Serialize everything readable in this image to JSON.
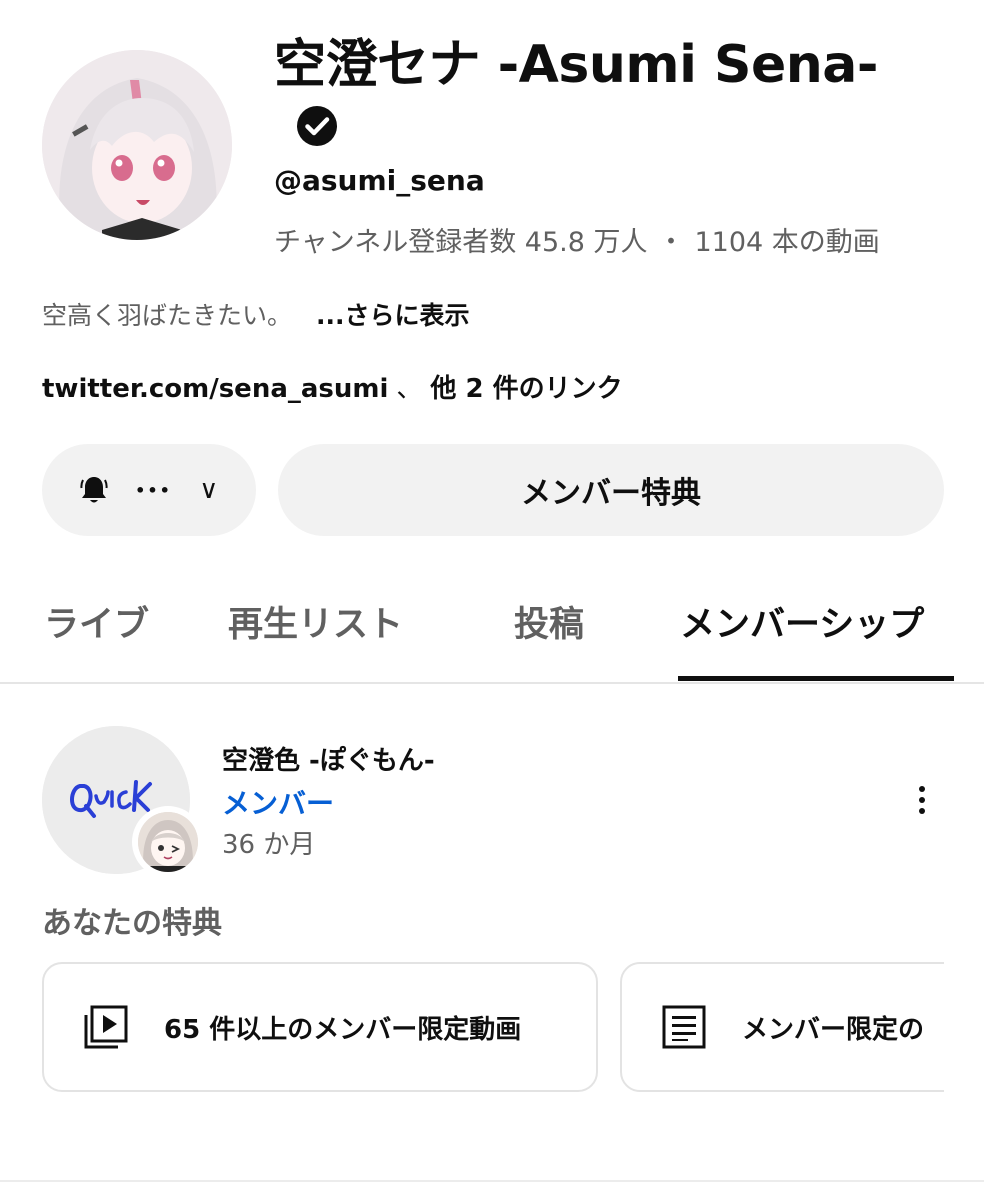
{
  "channel": {
    "name": "空澄セナ -Asumi Sena-",
    "handle": "@asumi_sena",
    "subscribers": "チャンネル登録者数 45.8 万人",
    "separator": "・",
    "video_count": "1104 本の動画",
    "description": "空高く羽ばたきたい。",
    "more_label": "...さらに表示",
    "link_url": "twitter.com/sena_asumi",
    "link_sep": "、",
    "link_more": "他 2 件のリンク"
  },
  "actions": {
    "bell_icon": "bell-icon",
    "more_dots": "•••",
    "chevron": "∨",
    "member_perks_label": "メンバー特典"
  },
  "tabs": [
    {
      "label": "ライブ",
      "active": false
    },
    {
      "label": "再生リスト",
      "active": false
    },
    {
      "label": "投稿",
      "active": false
    },
    {
      "label": "メンバーシップ",
      "active": true
    }
  ],
  "membership": {
    "title": "空澄色 -ぽぐもん-",
    "level": "メンバー",
    "duration": "36 か月",
    "perks_heading": "あなたの特典",
    "perks": [
      {
        "icon": "video-library-icon",
        "label": "65 件以上のメンバー限定動画"
      },
      {
        "icon": "article-icon",
        "label": "メンバー限定の"
      }
    ]
  },
  "colors": {
    "link_blue": "#065fd4",
    "secondary_text": "#606060",
    "pill_bg": "#f2f2f2"
  }
}
